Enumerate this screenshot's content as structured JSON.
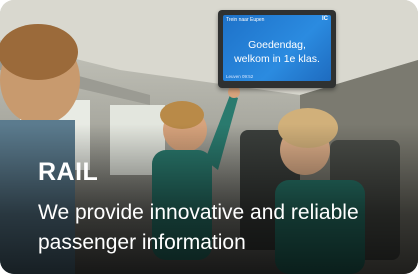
{
  "card": {
    "title": "RAIL",
    "description": "We provide innovative and reliable passenger information"
  },
  "screen": {
    "top_bar": "Trein naar Eupen",
    "logo_text": "IC",
    "line1": "Goedendag,",
    "line2": "welkom in 1e klas.",
    "bottom_bar": "Leuven 09:52"
  },
  "colors": {
    "screen_blue": "#2b8be0",
    "text": "#ffffff"
  }
}
